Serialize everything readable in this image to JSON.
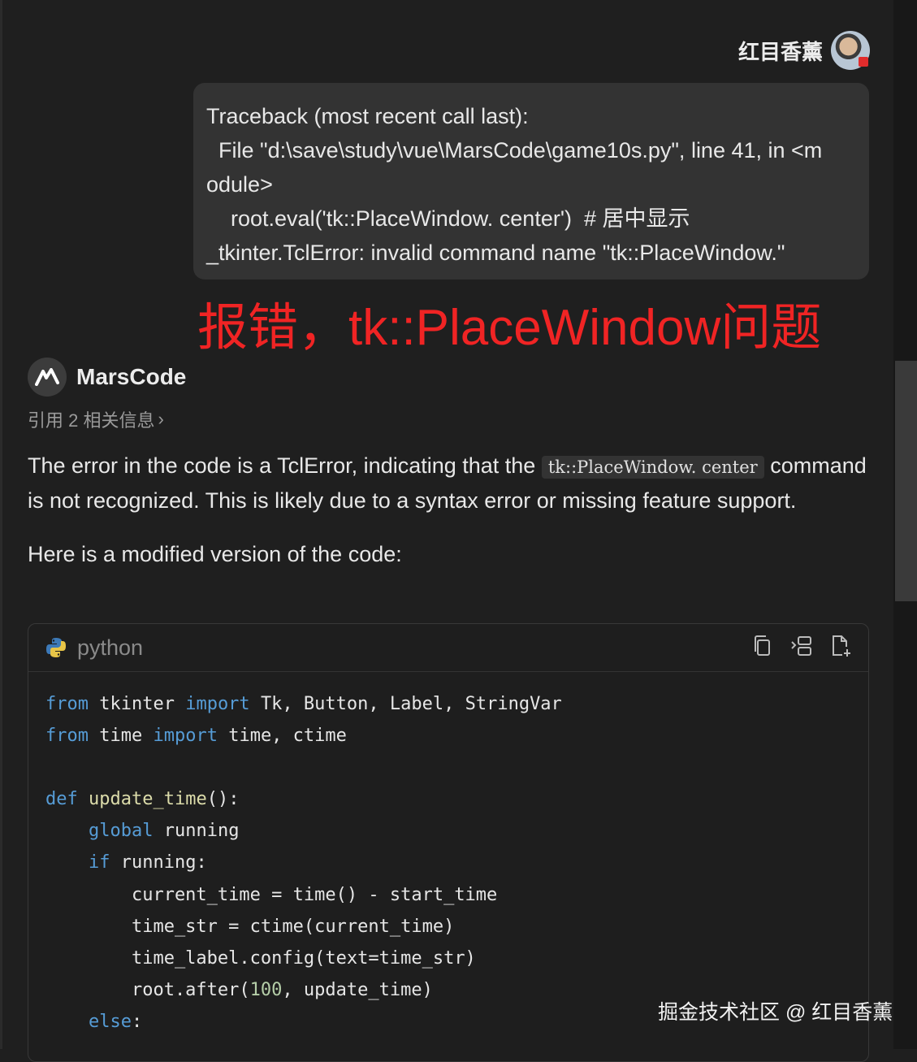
{
  "user": {
    "name": "红目香薰",
    "avatar": "avatar"
  },
  "user_message": {
    "lines": [
      "Traceback (most recent call last):",
      "  File \"d:\\save\\study\\vue\\MarsCode\\game10s.py\", line 41, in <m",
      "odule>",
      "    root.eval('tk::PlaceWindow. center')  # 居中显示",
      "_tkinter.TclError: invalid command name \"tk::PlaceWindow.\""
    ]
  },
  "annotation": "报错，tk::PlaceWindow问题",
  "assistant": {
    "name": "MarsCode",
    "logo_text": "M",
    "references": "引用 2 相关信息"
  },
  "answer": {
    "p1_before": "The error in the code is a TclError, indicating that the ",
    "p1_code": "tk::PlaceWindow. center",
    "p1_after": " command is not recognized. This is likely due to a syntax error or missing feature support.",
    "p2": "Here is a modified version of the code:"
  },
  "code_block": {
    "language": "python",
    "tools": [
      "copy-icon",
      "insert-icon",
      "new-file-icon"
    ],
    "lines": [
      [
        [
          "kw",
          "from"
        ],
        [
          "",
          "tkinter "
        ],
        [
          "kw",
          "import"
        ],
        [
          "",
          "Tk, Button, Label, StringVar"
        ]
      ],
      [
        [
          "kw",
          "from"
        ],
        [
          "",
          "time "
        ],
        [
          "kw",
          "import"
        ],
        [
          "",
          "time, ctime"
        ]
      ],
      [],
      [
        [
          "kw",
          "def"
        ],
        [
          "",
          ""
        ],
        [
          "fn",
          "update_time"
        ],
        [
          "",
          "():"
        ]
      ],
      [
        [
          "",
          "    "
        ],
        [
          "kw",
          "global"
        ],
        [
          "",
          "running"
        ]
      ],
      [
        [
          "",
          "    "
        ],
        [
          "kw",
          "if"
        ],
        [
          "",
          "running:"
        ]
      ],
      [
        [
          "",
          "        current_time = time() - start_time"
        ]
      ],
      [
        [
          "",
          "        time_str = ctime(current_time)"
        ]
      ],
      [
        [
          "",
          "        time_label.config(text=time_str)"
        ]
      ],
      [
        [
          "",
          "        root.after("
        ],
        [
          "num",
          "100"
        ],
        [
          "",
          ", update_time)"
        ]
      ],
      [
        [
          "",
          "    "
        ],
        [
          "kw",
          "else"
        ],
        [
          "",
          ":"
        ]
      ]
    ]
  },
  "watermark": "掘金技术社区 @ 红目香薰",
  "colors": {
    "annotation": "#f02424",
    "keyword": "#569cd6",
    "function": "#dcdcaa",
    "number": "#b5cea8"
  }
}
